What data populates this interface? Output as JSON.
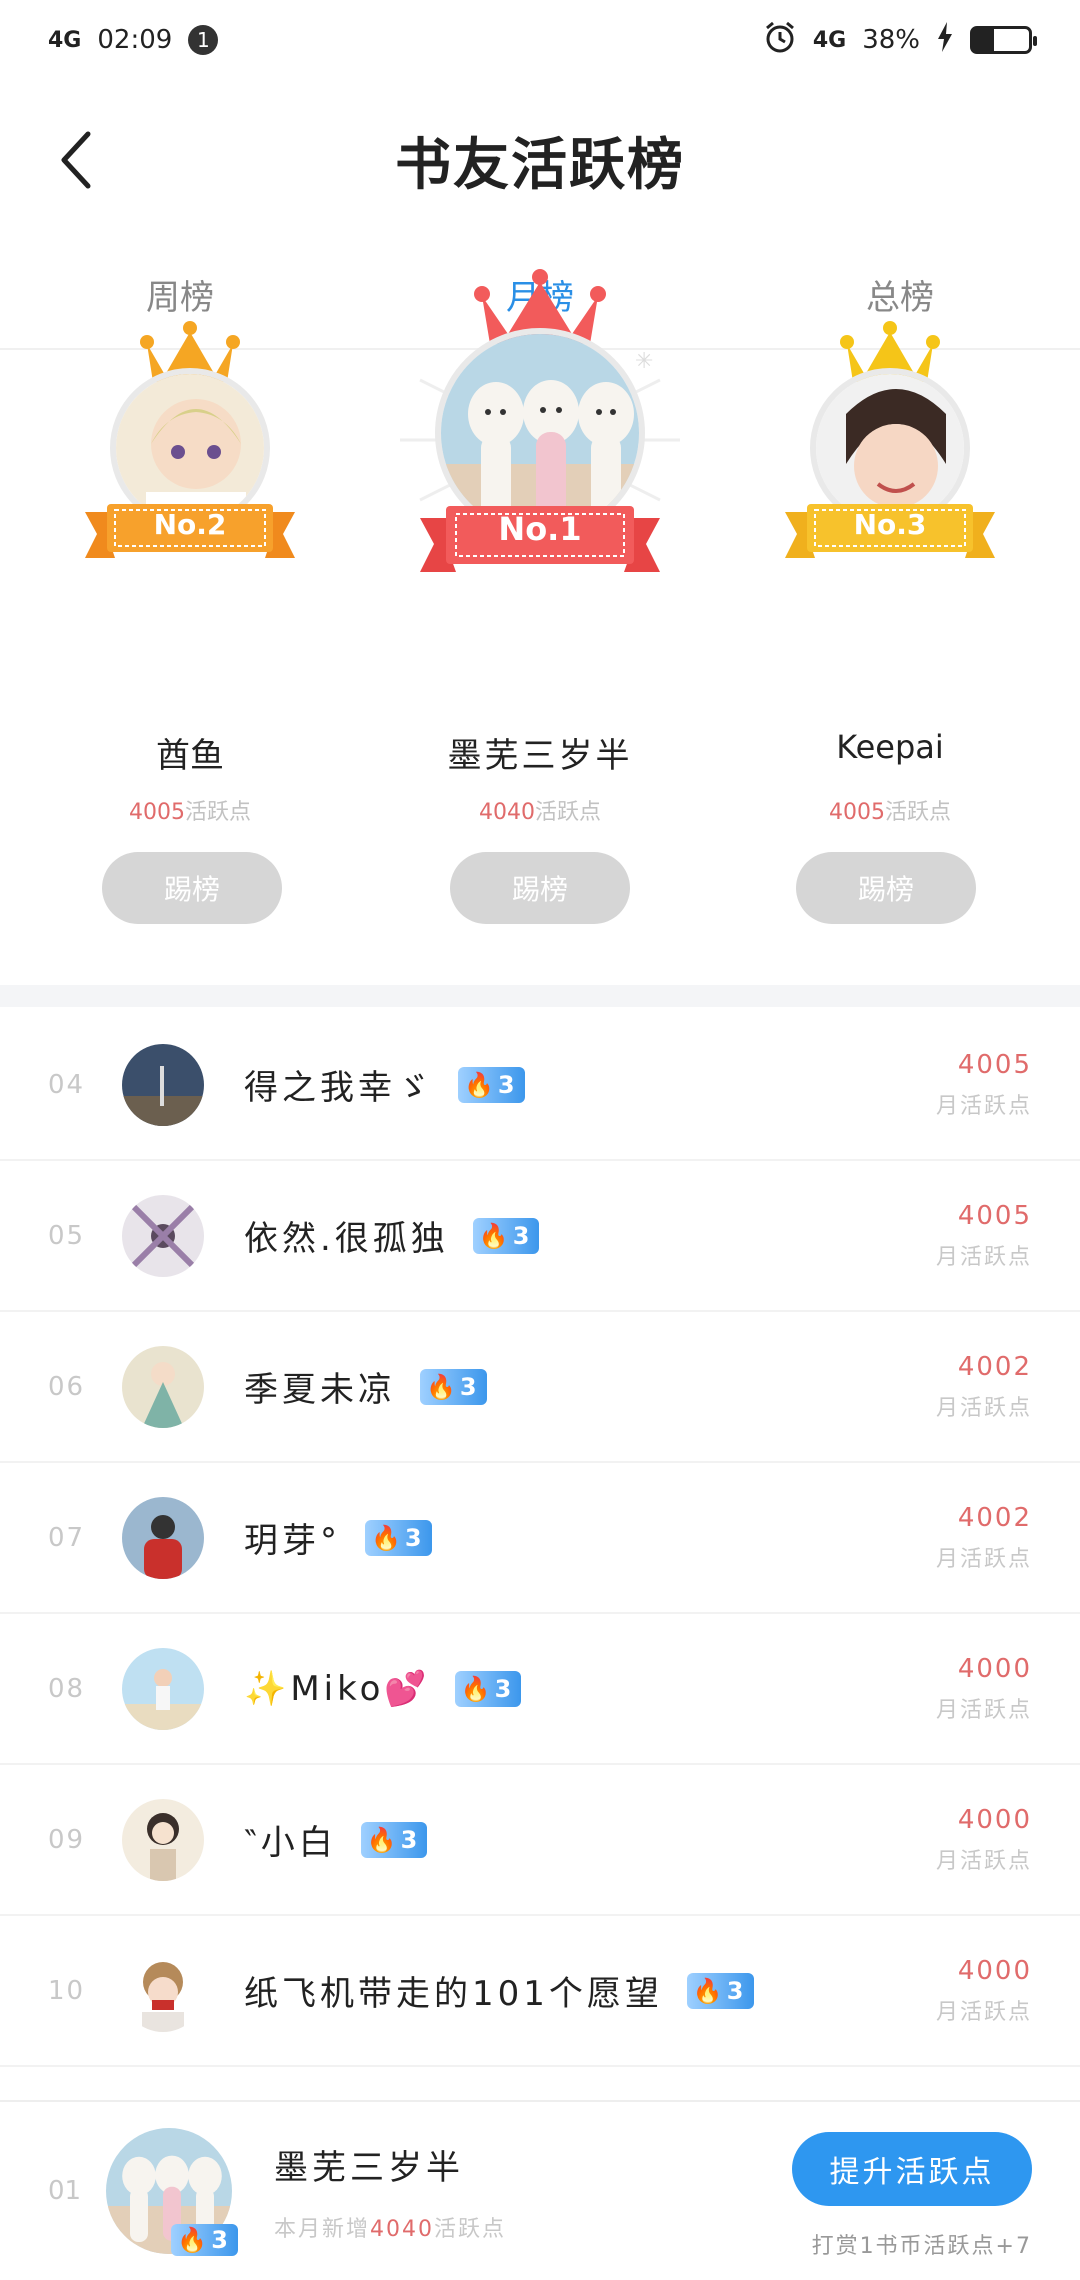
{
  "status_bar": {
    "time": "02:09",
    "network_left": "4G",
    "notification_count": "1",
    "network_right": "4G",
    "battery": "38%"
  },
  "header": {
    "title": "书友活跃榜"
  },
  "tabs": [
    {
      "label": "周榜",
      "active": false
    },
    {
      "label": "月榜",
      "active": true
    },
    {
      "label": "总榜",
      "active": false
    }
  ],
  "podium": {
    "second": {
      "badge": "No.2",
      "name": "酋鱼",
      "points": "4005",
      "unit": "活跃点",
      "button": "踢榜"
    },
    "first": {
      "badge": "No.1",
      "name": "墨芜三岁半",
      "points": "4040",
      "unit": "活跃点",
      "button": "踢榜"
    },
    "third": {
      "badge": "No.3",
      "name": "Keepai",
      "points": "4005",
      "unit": "活跃点",
      "button": "踢榜"
    }
  },
  "rows": [
    {
      "rank": "04",
      "name": "得之我幸ゞ",
      "level": "3",
      "points": "4005",
      "unit": "月活跃点"
    },
    {
      "rank": "05",
      "name": "依然.很孤独",
      "level": "3",
      "points": "4005",
      "unit": "月活跃点"
    },
    {
      "rank": "06",
      "name": "季夏未凉",
      "level": "3",
      "points": "4002",
      "unit": "月活跃点"
    },
    {
      "rank": "07",
      "name": "玥芽°",
      "level": "3",
      "points": "4002",
      "unit": "月活跃点"
    },
    {
      "rank": "08",
      "name": "✨Miko💕",
      "level": "3",
      "points": "4000",
      "unit": "月活跃点"
    },
    {
      "rank": "09",
      "name": "‶小白",
      "level": "3",
      "points": "4000",
      "unit": "月活跃点"
    },
    {
      "rank": "10",
      "name": "纸飞机带走的101个愿望",
      "level": "3",
      "points": "4000",
      "unit": "月活跃点"
    }
  ],
  "me": {
    "rank": "01",
    "name": "墨芜三岁半",
    "level": "3",
    "sub_prefix": "本月新增",
    "sub_points": "4040",
    "sub_suffix": "活跃点",
    "boost_button": "提升活跃点",
    "reward_tip": "打赏1书币活跃点+7"
  },
  "colors": {
    "accent": "#2a8fe6",
    "points_red": "#e06b6b",
    "crown_gold": "#f5a623",
    "crown_red": "#f25b5b"
  }
}
